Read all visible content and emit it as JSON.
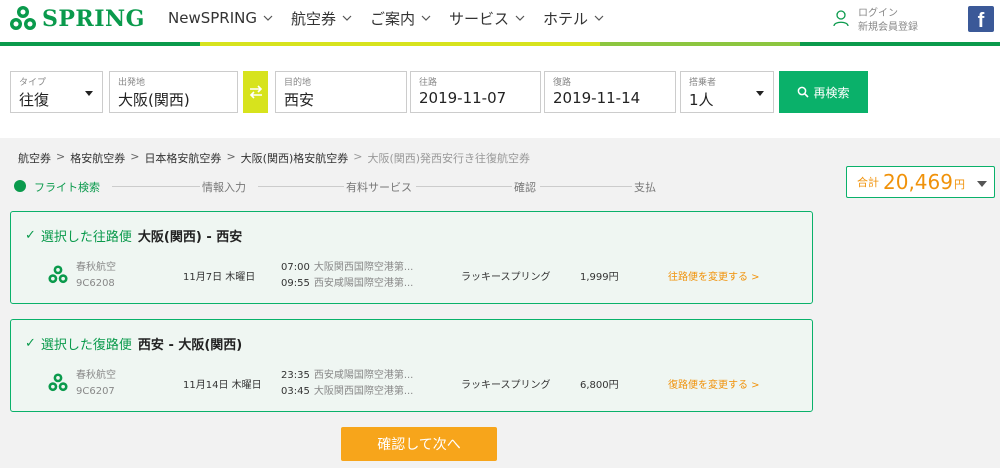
{
  "header": {
    "logo_text": "SPRING",
    "nav": [
      {
        "label": "NewSPRING"
      },
      {
        "label": "航空券"
      },
      {
        "label": "ご案内"
      },
      {
        "label": "サービス"
      },
      {
        "label": "ホテル"
      }
    ],
    "login_label": "ログイン",
    "register_label": "新規会員登録",
    "facebook_label": "f"
  },
  "colors": {
    "brand_green": "#0a9a4c",
    "accent_yellow": "#d7e31d",
    "orange": "#f0920a",
    "button_green": "#0ab16a"
  },
  "search": {
    "type": {
      "label": "タイプ",
      "value": "往復"
    },
    "origin": {
      "label": "出発地",
      "value": "大阪(関西)"
    },
    "destination": {
      "label": "目的地",
      "value": "西安"
    },
    "depart": {
      "label": "往路",
      "value": "2019-11-07"
    },
    "return": {
      "label": "復路",
      "value": "2019-11-14"
    },
    "passengers": {
      "label": "搭乗者",
      "value": "1人"
    },
    "search_button": "再検索"
  },
  "breadcrumb": [
    "航空券",
    "格安航空券",
    "日本格安航空券",
    "大阪(関西)格安航空券",
    "大阪(関西)発西安行き往復航空券"
  ],
  "breadcrumb_sep": ">",
  "steps": [
    "フライト検索",
    "情報入力",
    "有料サービス",
    "確認",
    "支払"
  ],
  "total": {
    "label": "合計",
    "value": "20,469",
    "unit": "円"
  },
  "outbound": {
    "check": "✓",
    "label": "選択した往路便",
    "route": "大阪(関西) - 西安",
    "airline": "春秋航空",
    "flight_no": "9C6208",
    "date": "11月7日 木曜日",
    "dep_time": "07:00",
    "dep_airport": "大阪関西国際空港第...",
    "arr_time": "09:55",
    "arr_airport": "西安咸陽国際空港第...",
    "fare": "ラッキースプリング",
    "price": "1,999円",
    "change": "往路便を変更する >"
  },
  "inbound": {
    "check": "✓",
    "label": "選択した復路便",
    "route": "西安 - 大阪(関西)",
    "airline": "春秋航空",
    "flight_no": "9C6207",
    "date": "11月14日 木曜日",
    "dep_time": "23:35",
    "dep_airport": "西安咸陽国際空港第...",
    "arr_time": "03:45",
    "arr_airport": "大阪関西国際空港第...",
    "fare": "ラッキースプリング",
    "price": "6,800円",
    "change": "復路便を変更する >"
  },
  "next_button": "確認して次へ"
}
